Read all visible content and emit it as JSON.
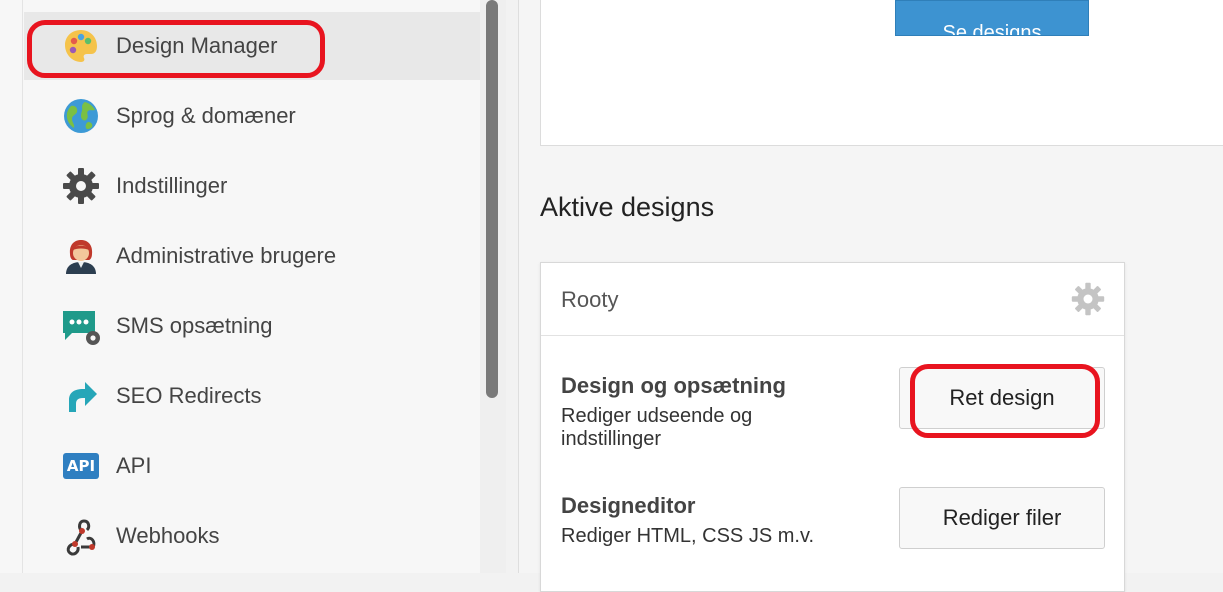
{
  "sidebar": {
    "items": [
      {
        "label": "Design Manager",
        "icon": "palette-icon",
        "active": true
      },
      {
        "label": "Sprog & domæner",
        "icon": "globe-icon"
      },
      {
        "label": "Indstillinger",
        "icon": "gear-icon"
      },
      {
        "label": "Administrative brugere",
        "icon": "admin-user-icon"
      },
      {
        "label": "SMS opsætning",
        "icon": "sms-settings-icon"
      },
      {
        "label": "SEO Redirects",
        "icon": "redirect-arrow-icon"
      },
      {
        "label": "API",
        "icon": "api-icon",
        "icon_text": "API"
      },
      {
        "label": "Webhooks",
        "icon": "webhooks-icon"
      }
    ]
  },
  "top": {
    "see_designs_label": "Se designs"
  },
  "main": {
    "section_title": "Aktive designs",
    "card": {
      "title": "Rooty",
      "rows": [
        {
          "title": "Design og opsætning",
          "desc": "Rediger udseende og indstillinger",
          "button": "Ret design"
        },
        {
          "title": "Designeditor",
          "desc": "Rediger HTML, CSS JS m.v.",
          "button": "Rediger filer"
        }
      ]
    }
  },
  "colors": {
    "highlight": "#e8141f",
    "primary_button": "#3d93d1"
  }
}
